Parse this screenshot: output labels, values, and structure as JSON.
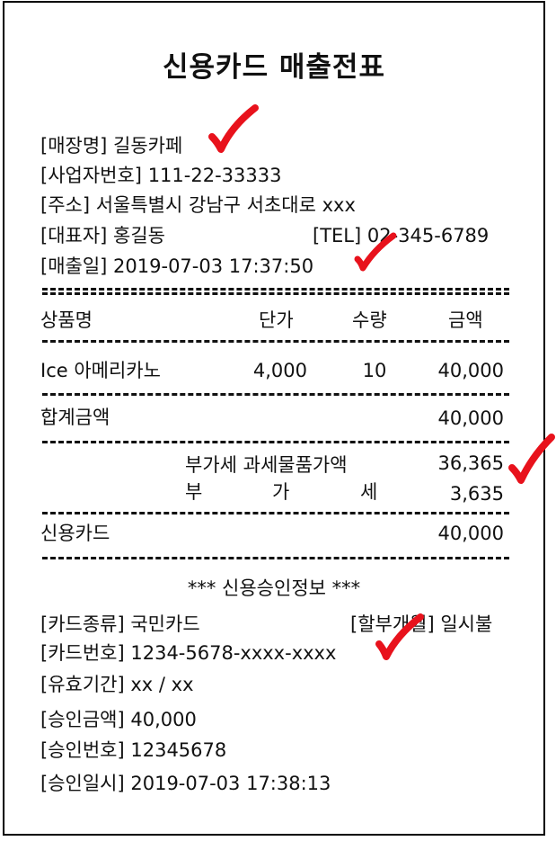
{
  "title": "신용카드 매출전표",
  "store": {
    "name_label": "[매장명]",
    "name": "길동카페",
    "biz_label": "[사업자번호]",
    "biz_no": "111-22-33333",
    "addr_label": "[주소]",
    "address": "서울특별시 강남구 서초대로 xxx",
    "rep_label": "[대표자]",
    "rep": "홍길동",
    "tel_label": "[TEL]",
    "tel": "02-345-6789",
    "date_label": "[매출일]",
    "sale_date": "2019-07-03 17:37:50"
  },
  "columns": {
    "item": "상품명",
    "price": "단가",
    "qty": "수량",
    "amount": "금액"
  },
  "items": [
    {
      "name": "Ice 아메리카노",
      "price": "4,000",
      "qty": "10",
      "amount": "40,000"
    }
  ],
  "total": {
    "label": "합계금액",
    "value": "40,000"
  },
  "tax": {
    "supply_label": "부가세 과세물품가액",
    "supply_value": "36,365",
    "vat_chars": [
      "부",
      "가",
      "세"
    ],
    "vat_value": "3,635"
  },
  "card_total": {
    "label": "신용카드",
    "value": "40,000"
  },
  "approval": {
    "header": "*** 신용승인정보 ***",
    "card_type_label": "[카드종류]",
    "card_type": "국민카드",
    "installment_label": "[할부개월]",
    "installment": "일시불",
    "card_no_label": "[카드번호]",
    "card_no": "1234-5678-xxxx-xxxx",
    "expiry_label": "[유효기간]",
    "expiry": "xx / xx",
    "amount_label": "[승인금액]",
    "amount": "40,000",
    "approval_no_label": "[승인번호]",
    "approval_no": "12345678",
    "approval_date_label": "[승인일시]",
    "approval_date": "2019-07-03 17:38:13"
  },
  "marks": {
    "color": "#e8121c",
    "icon": "checkmark-icon"
  }
}
